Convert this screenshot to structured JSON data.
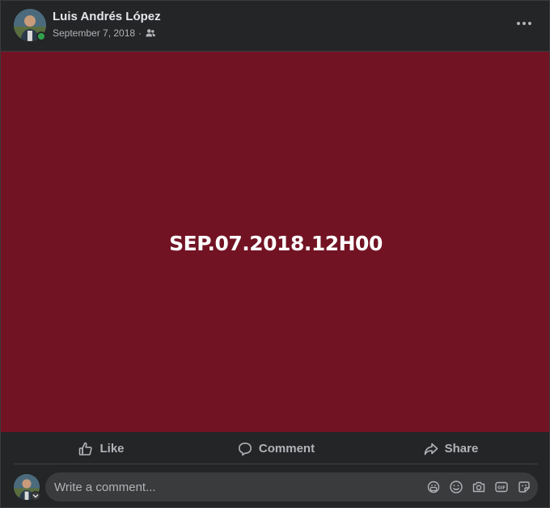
{
  "post": {
    "author": "Luis Andrés López",
    "date": "September 7, 2018",
    "separator": "·",
    "audience_icon": "friends-icon",
    "banner_text": "SEP.07.2018.12H00",
    "banner_color": "#721324",
    "online": true
  },
  "actions": {
    "like": "Like",
    "comment": "Comment",
    "share": "Share"
  },
  "comment_box": {
    "placeholder": "Write a comment...",
    "icons": [
      "avatar-sticker-icon",
      "emoji-icon",
      "camera-icon",
      "gif-icon",
      "sticker-icon"
    ]
  },
  "colors": {
    "card": "#242526",
    "text": "#e4e6eb",
    "muted": "#b0b3b8",
    "online": "#31a24c"
  }
}
